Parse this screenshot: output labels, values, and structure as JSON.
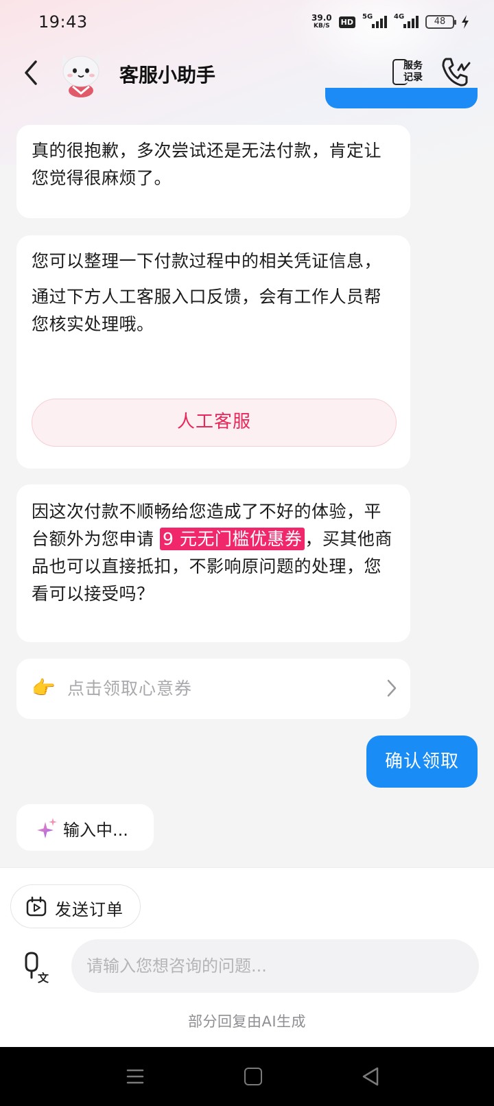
{
  "status_bar": {
    "time": "19:43",
    "net_speed": "39.0",
    "net_unit": "KB/S",
    "hd": "HD",
    "signal1_label": "5G",
    "signal2_label": "4G",
    "battery": "48"
  },
  "header": {
    "title": "客服小助手",
    "records_label_line1": "服务",
    "records_label_line2": "记录"
  },
  "messages": {
    "m1": "真的很抱歉，多次尝试还是无法付款，肯定让您觉得很麻烦了。",
    "m2_p1": "您可以整理一下付款过程中的相关凭证信息，",
    "m2_p2": "通过下方人工客服入口反馈，会有工作人员帮您核实处理哦。",
    "human_service_button": "人工客服",
    "m3_before": "因这次付款不顺畅给您造成了不好的体验，平台额外为您申请",
    "m3_highlight": "9 元无门槛优惠券",
    "m3_after": "，买其他商品也可以直接抵扣，不影响原问题的处理，您看可以接受吗？",
    "coupon_card_label": "点击领取心意券",
    "coupon_card_emoji": "👉",
    "sent_message": "确认领取",
    "typing_indicator": "输入中..."
  },
  "bottom": {
    "send_order_label": "发送订单",
    "input_placeholder": "请输入您想咨询的问题...",
    "ai_note": "部分回复由AI生成"
  },
  "colors": {
    "accent_blue": "#1a8cf6",
    "highlight_pink": "#f0276a",
    "button_text_red": "#e8285a"
  },
  "icons": [
    "back-arrow-icon",
    "avatar-cat-icon",
    "service-records-icon",
    "phone-icon",
    "pointing-hand-icon",
    "chevron-right-icon",
    "sparkle-icon",
    "send-order-icon",
    "voice-translate-icon",
    "nav-menu-icon",
    "nav-home-icon",
    "nav-back-icon"
  ]
}
